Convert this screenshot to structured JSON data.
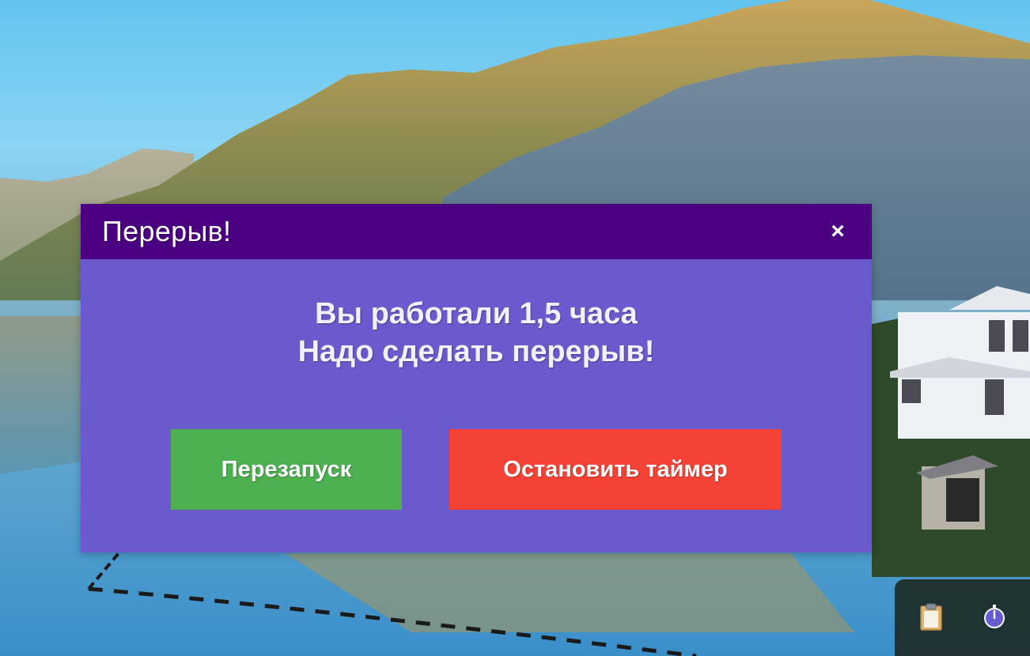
{
  "dialog": {
    "title": "Перерыв!",
    "close_label": "×",
    "message_line1": "Вы работали 1,5 часа",
    "message_line2": "Надо сделать перерыв!",
    "restart_label": "Перезапуск",
    "stop_label": "Остановить таймер"
  },
  "toolbar": {
    "icons": [
      "clipboard-icon",
      "timer-icon"
    ]
  },
  "colors": {
    "header": "#4b0082",
    "body": "#6a5acd",
    "restart": "#4caf50",
    "stop": "#f44336"
  }
}
